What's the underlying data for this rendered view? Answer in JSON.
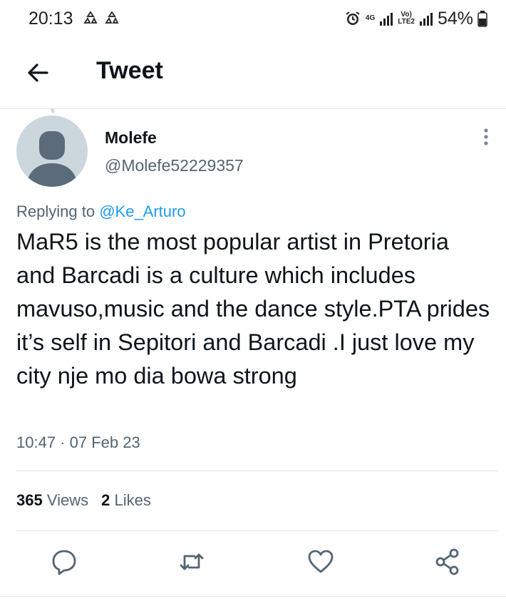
{
  "status_bar": {
    "time": "20:13",
    "network_tag": "4G",
    "volte_tag": "Vo)",
    "lte_tag": "LTE2",
    "battery": "54%"
  },
  "header": {
    "title": "Tweet"
  },
  "tweet": {
    "author_name": "Molefe",
    "author_handle": "@Molefe52229357",
    "replying_prefix": "Replying to",
    "replying_to": "@Ke_Arturo",
    "text": "MaR5 is the most popular artist in Pretoria and Barcadi is a culture which includes mavuso,music and the dance style.PTA prides it’s self in Sepitori and Barcadi .I just love my city nje mo dia bowa strong",
    "timestamp": "10:47 · 07 Feb 23",
    "views_count": "365",
    "views_label": "Views",
    "likes_count": "2",
    "likes_label": "Likes"
  },
  "icons": {
    "back": "arrow-left-icon",
    "more": "more-vertical-icon",
    "reply": "reply-icon",
    "retweet": "retweet-icon",
    "like": "heart-icon",
    "share": "share-icon"
  },
  "colors": {
    "accent": "#1d9bf0",
    "text_primary": "#0f1419",
    "text_secondary": "#536471",
    "avatar_bg": "#ccd6dd",
    "icon_gray": "#536471"
  }
}
